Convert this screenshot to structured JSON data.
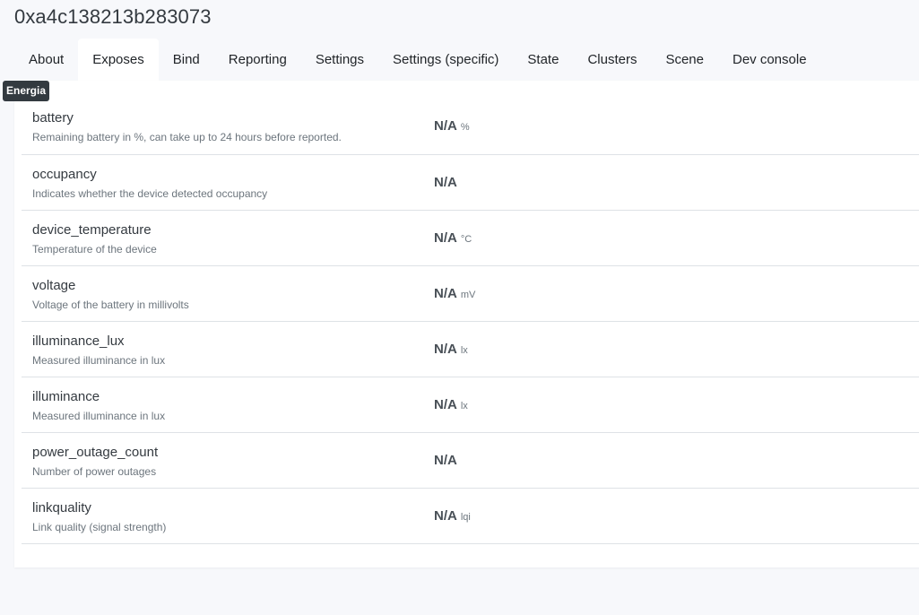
{
  "device": {
    "title": "0xa4c138213b283073"
  },
  "tabs": [
    {
      "label": "About"
    },
    {
      "label": "Exposes"
    },
    {
      "label": "Bind"
    },
    {
      "label": "Reporting"
    },
    {
      "label": "Settings"
    },
    {
      "label": "Settings (specific)"
    },
    {
      "label": "State"
    },
    {
      "label": "Clusters"
    },
    {
      "label": "Scene"
    },
    {
      "label": "Dev console"
    }
  ],
  "active_tab": "Exposes",
  "tooltip": {
    "text": "Energia"
  },
  "exposes": [
    {
      "name": "battery",
      "description": "Remaining battery in %, can take up to 24 hours before reported.",
      "value": "N/A",
      "unit": "%"
    },
    {
      "name": "occupancy",
      "description": "Indicates whether the device detected occupancy",
      "value": "N/A",
      "unit": ""
    },
    {
      "name": "device_temperature",
      "description": "Temperature of the device",
      "value": "N/A",
      "unit": "°C"
    },
    {
      "name": "voltage",
      "description": "Voltage of the battery in millivolts",
      "value": "N/A",
      "unit": "mV"
    },
    {
      "name": "illuminance_lux",
      "description": "Measured illuminance in lux",
      "value": "N/A",
      "unit": "lx"
    },
    {
      "name": "illuminance",
      "description": "Measured illuminance in lux",
      "value": "N/A",
      "unit": "lx"
    },
    {
      "name": "power_outage_count",
      "description": "Number of power outages",
      "value": "N/A",
      "unit": ""
    },
    {
      "name": "linkquality",
      "description": "Link quality (signal strength)",
      "value": "N/A",
      "unit": "lqi"
    }
  ]
}
